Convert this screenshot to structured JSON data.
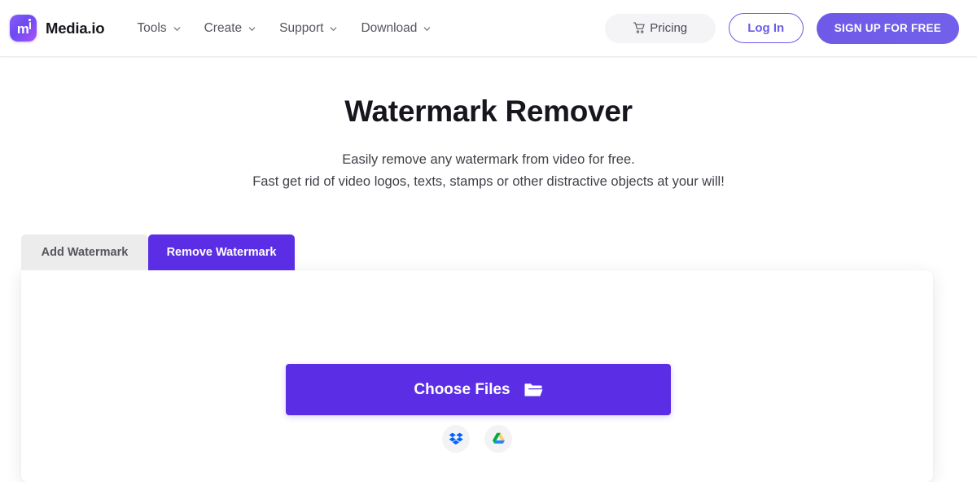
{
  "header": {
    "brand_name": "Media.io",
    "logo_icon": "media-io-logo-icon",
    "nav_items": [
      {
        "label": "Tools",
        "icon": "chevron-down-icon"
      },
      {
        "label": "Create",
        "icon": "chevron-down-icon"
      },
      {
        "label": "Support",
        "icon": "chevron-down-icon"
      },
      {
        "label": "Download",
        "icon": "chevron-down-icon"
      }
    ],
    "pricing_label": "Pricing",
    "pricing_icon": "shopping-cart-icon",
    "login_label": "Log In",
    "signup_label": "SIGN UP FOR FREE"
  },
  "hero": {
    "title": "Watermark Remover",
    "subtitle_line1": "Easily remove any watermark from video for free.",
    "subtitle_line2": "Fast get rid of video logos, texts, stamps or other distractive objects at your will!"
  },
  "tabs": [
    {
      "label": "Add Watermark",
      "active": false
    },
    {
      "label": "Remove Watermark",
      "active": true
    }
  ],
  "upload": {
    "choose_files_label": "Choose Files",
    "folder_icon": "folder-open-icon",
    "cloud_sources": [
      {
        "name": "dropbox-icon",
        "label": "Dropbox"
      },
      {
        "name": "google-drive-icon",
        "label": "Google Drive"
      }
    ]
  },
  "colors": {
    "brand_purple": "#6c5ce7",
    "accent_purple": "#5b2ee5",
    "tab_inactive_bg": "#ececec",
    "page_bg": "#ffffff",
    "text_dark": "#16161c",
    "text_muted": "#55555f",
    "dropbox_blue": "#0061ff",
    "drive_yellow": "#ffcf63",
    "drive_green": "#00ac47",
    "drive_blue": "#2684fc"
  }
}
